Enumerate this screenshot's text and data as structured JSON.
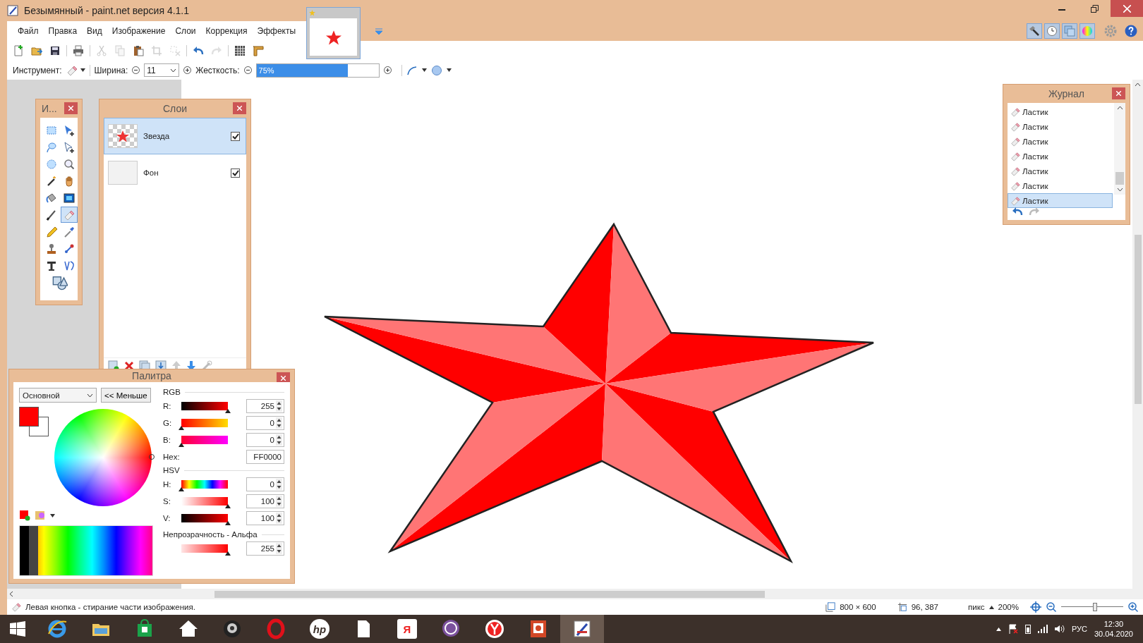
{
  "window": {
    "title": "Безымянный - paint.net версия 4.1.1"
  },
  "menu": [
    "Файл",
    "Правка",
    "Вид",
    "Изображение",
    "Слои",
    "Коррекция",
    "Эффекты"
  ],
  "panel_toggles": [
    {
      "kind": "hammer",
      "selected": true
    },
    {
      "kind": "clock",
      "selected": true
    },
    {
      "kind": "layers",
      "selected": true
    },
    {
      "kind": "wheel",
      "selected": true
    }
  ],
  "toolbar": [
    {
      "kind": "new",
      "disabled": false
    },
    {
      "kind": "open",
      "disabled": false
    },
    {
      "kind": "save",
      "disabled": false
    },
    {
      "kind": "sep"
    },
    {
      "kind": "print",
      "disabled": false
    },
    {
      "kind": "sep"
    },
    {
      "kind": "cut",
      "disabled": true
    },
    {
      "kind": "copy",
      "disabled": true
    },
    {
      "kind": "paste",
      "disabled": false
    },
    {
      "kind": "crop",
      "disabled": true
    },
    {
      "kind": "deselect",
      "disabled": true
    },
    {
      "kind": "sep"
    },
    {
      "kind": "undo",
      "disabled": false
    },
    {
      "kind": "redo",
      "disabled": true
    },
    {
      "kind": "sep"
    },
    {
      "kind": "grid",
      "disabled": false
    },
    {
      "kind": "ruler",
      "disabled": false
    }
  ],
  "options": {
    "tool_label": "Инструмент:",
    "width_label": "Ширина:",
    "width_value": "11",
    "hardness_label": "Жесткость:",
    "hardness": {
      "text": "75%",
      "level": 0.75
    }
  },
  "tools_window": {
    "title": "И...",
    "tools": [
      {
        "kind": "rectsel",
        "selected": false
      },
      {
        "kind": "move",
        "selected": false
      },
      {
        "kind": "lasso",
        "selected": false
      },
      {
        "kind": "movesel",
        "selected": false
      },
      {
        "kind": "ellipsesel",
        "selected": false
      },
      {
        "kind": "zoom",
        "selected": false
      },
      {
        "kind": "wand",
        "selected": false
      },
      {
        "kind": "pan",
        "selected": false
      },
      {
        "kind": "bucket",
        "selected": false
      },
      {
        "kind": "gradient",
        "selected": false
      },
      {
        "kind": "brush",
        "selected": false
      },
      {
        "kind": "eraser",
        "selected": true
      },
      {
        "kind": "pencil",
        "selected": false
      },
      {
        "kind": "picker",
        "selected": false
      },
      {
        "kind": "stamp",
        "selected": false
      },
      {
        "kind": "recolor",
        "selected": false
      },
      {
        "kind": "text",
        "selected": false
      },
      {
        "kind": "line",
        "selected": false
      },
      {
        "kind": "shapes",
        "selected": false
      }
    ]
  },
  "layers_window": {
    "title": "Слои",
    "layers": [
      {
        "name": "Звезда",
        "kind": "star",
        "selected": true,
        "visible": true
      },
      {
        "name": "Фон",
        "kind": "blank",
        "selected": false,
        "visible": true
      }
    ]
  },
  "palette_window": {
    "title": "Палитра",
    "mode": "Основной",
    "less_button": "<< Меньше",
    "rgb_label": "RGB",
    "rgb": [
      {
        "kind": "r",
        "label": "R:",
        "value": "255",
        "level": 1
      },
      {
        "kind": "g",
        "label": "G:",
        "value": "0",
        "level": 0
      },
      {
        "kind": "b",
        "label": "B:",
        "value": "0",
        "level": 0
      }
    ],
    "hex_label": "Hex:",
    "hex": "FF0000",
    "hsv_label": "HSV",
    "hsv": [
      {
        "kind": "h",
        "label": "H:",
        "value": "0",
        "level": 0
      },
      {
        "kind": "s",
        "label": "S:",
        "value": "100",
        "level": 1
      },
      {
        "kind": "v",
        "label": "V:",
        "value": "100",
        "level": 1
      }
    ],
    "alpha_label": "Непрозрачность - Альфа",
    "alpha": {
      "kind": "a",
      "value": "255",
      "level": 1
    }
  },
  "history_window": {
    "title": "Журнал",
    "items": [
      {
        "label": "Ластик",
        "selected": false
      },
      {
        "label": "Ластик",
        "selected": false
      },
      {
        "label": "Ластик",
        "selected": false
      },
      {
        "label": "Ластик",
        "selected": false
      },
      {
        "label": "Ластик",
        "selected": false
      },
      {
        "label": "Ластик",
        "selected": false
      },
      {
        "label": "Ластик",
        "selected": true
      }
    ]
  },
  "status_bar": {
    "hint": "Левая кнопка - стирание части изображения.",
    "size": "800 × 600",
    "position": "96, 387",
    "unit": "пикс",
    "zoom": "200%",
    "zoom_slider": {
      "level": 0.55
    }
  },
  "taskbar": {
    "apps": [
      {
        "kind": "ie",
        "selected": false
      },
      {
        "kind": "explorer",
        "selected": false
      },
      {
        "kind": "store",
        "selected": false
      },
      {
        "kind": "home",
        "selected": false
      },
      {
        "kind": "camera",
        "selected": false
      },
      {
        "kind": "opera",
        "selected": false
      },
      {
        "kind": "hp",
        "selected": false,
        "glyph": "hp"
      },
      {
        "kind": "file",
        "selected": false
      },
      {
        "kind": "yandex",
        "selected": false,
        "glyph": "Я"
      },
      {
        "kind": "viber",
        "selected": false
      },
      {
        "kind": "ybrowser",
        "selected": false
      },
      {
        "kind": "powerpoint",
        "selected": false
      },
      {
        "kind": "paintnet",
        "selected": true
      }
    ],
    "language": "РУС",
    "time": "12:30",
    "date": "30.04.2020"
  }
}
